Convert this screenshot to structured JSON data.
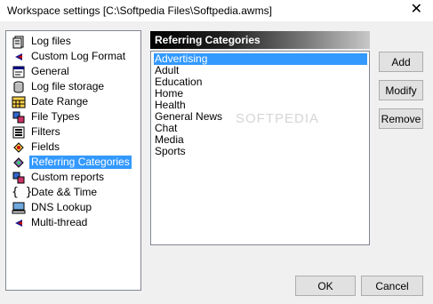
{
  "window": {
    "title": "Workspace settings [C:\\Softpedia Files\\Softpedia.awms]",
    "close_glyph": "✕"
  },
  "nav": {
    "items": [
      {
        "label": "Log files",
        "icon": "log-files-icon"
      },
      {
        "label": "Custom Log Format",
        "icon": "custom-log-format-icon"
      },
      {
        "label": "General",
        "icon": "general-icon"
      },
      {
        "label": "Log file storage",
        "icon": "storage-icon"
      },
      {
        "label": "Date Range",
        "icon": "calendar-icon"
      },
      {
        "label": "File Types",
        "icon": "file-types-icon"
      },
      {
        "label": "Filters",
        "icon": "filters-icon"
      },
      {
        "label": "Fields",
        "icon": "fields-icon"
      },
      {
        "label": "Referring Categories",
        "icon": "referring-categories-icon",
        "selected": true
      },
      {
        "label": "Custom reports",
        "icon": "custom-reports-icon"
      },
      {
        "label": "Date && Time",
        "icon": "braces-icon"
      },
      {
        "label": "DNS Lookup",
        "icon": "computer-icon"
      },
      {
        "label": "Multi-thread",
        "icon": "multi-thread-icon"
      }
    ]
  },
  "panel": {
    "header": "Referring Categories"
  },
  "categories": {
    "selected_index": 0,
    "items": [
      "Advertising",
      "Adult",
      "Education",
      "Home",
      "Health",
      "General News",
      "Chat",
      "Media",
      "Sports"
    ]
  },
  "buttons": {
    "add": "Add",
    "modify": "Modify",
    "remove": "Remove",
    "ok": "OK",
    "cancel": "Cancel"
  },
  "watermark": "SOFTPEDIA"
}
